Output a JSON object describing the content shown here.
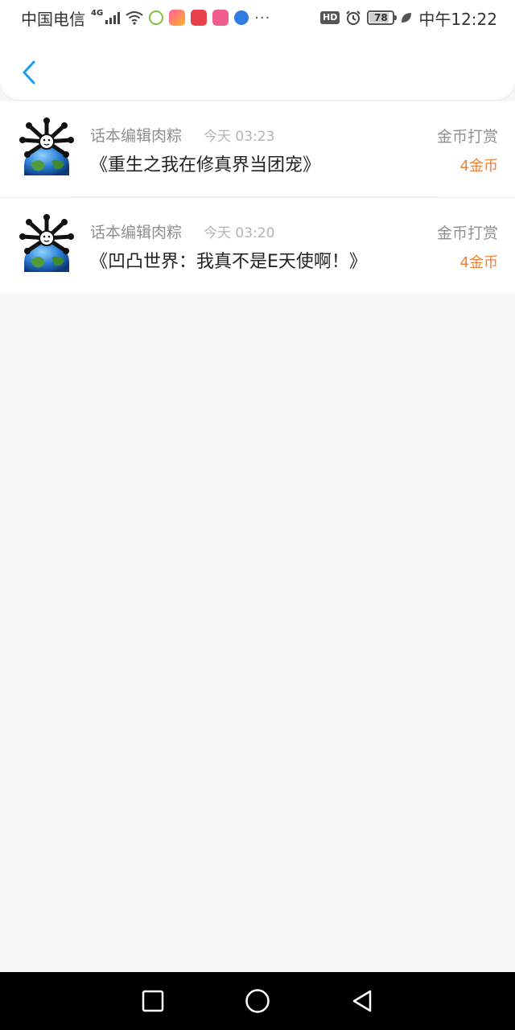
{
  "status_bar": {
    "carrier": "中国电信",
    "network": "4G",
    "hd": "HD",
    "battery": "78",
    "battery_level": 0.78,
    "time": "中午12:22",
    "more": "···",
    "icons": [
      "signal-icon",
      "wifi-icon",
      "app-icon-bird",
      "app-icon-pink",
      "app-icon-huawei",
      "app-icon-bilibili",
      "app-icon-browser",
      "alarm-icon",
      "leaf-icon"
    ]
  },
  "header": {
    "back_icon": "chevron-left-icon"
  },
  "records": [
    {
      "name": "话本编辑肉粽",
      "time": "今天 03:23",
      "title": "《重生之我在修真界当团宠》",
      "type": "金币打赏",
      "amount": "4金币"
    },
    {
      "name": "话本编辑肉粽",
      "time": "今天 03:20",
      "title": "《凹凸世界：我真不是E天使啊！》",
      "type": "金币打赏",
      "amount": "4金币"
    }
  ],
  "colors": {
    "accent": "#1a9ff0",
    "amount": "#e8823d",
    "background": "#f8f6f7"
  },
  "nav": {
    "icons": [
      "recent-apps-icon",
      "home-icon",
      "back-triangle-icon"
    ]
  }
}
